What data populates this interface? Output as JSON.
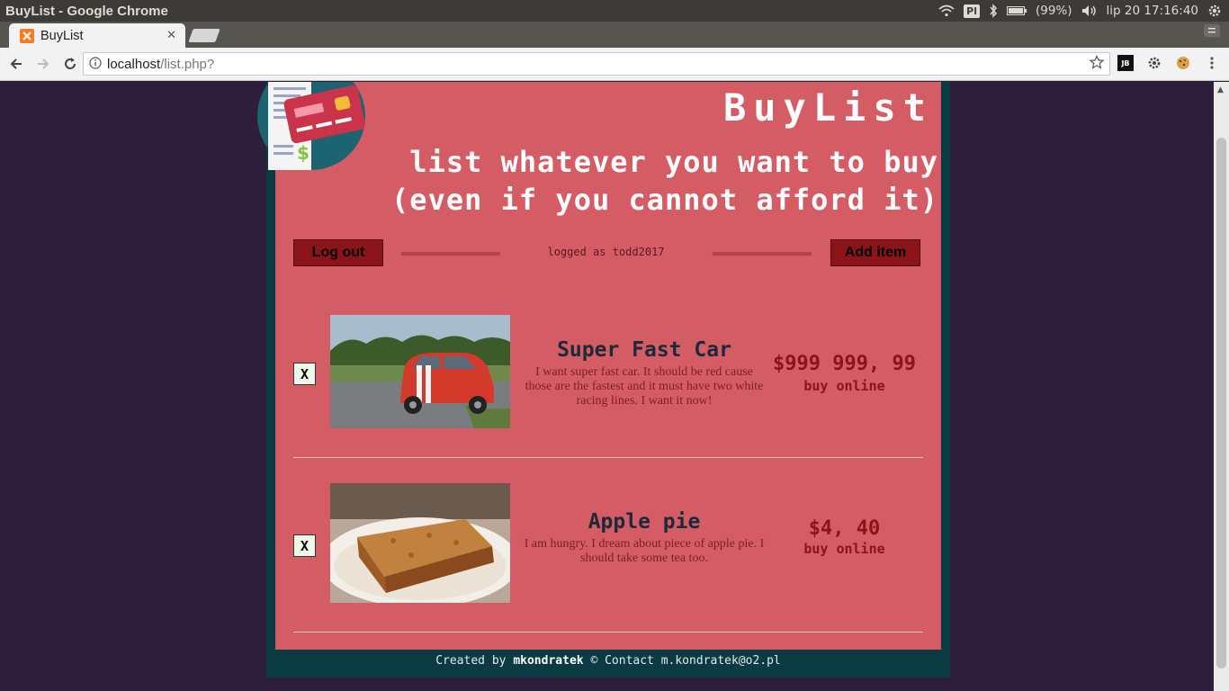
{
  "os": {
    "window_title": "BuyList - Google Chrome",
    "keyboard_layout": "Pl",
    "battery": "(99%)",
    "datetime": "lip 20 17:16:40"
  },
  "browser": {
    "tab_title": "BuyList",
    "url_host": "localhost",
    "url_path": "/list.php?"
  },
  "header": {
    "title": "BuyList",
    "tagline_1": "list whatever you want to buy",
    "tagline_2": "(even if you cannot afford it)"
  },
  "controls": {
    "logout_label": "Log out",
    "logged_as": "logged as todd2017",
    "add_label": "Add item"
  },
  "items": [
    {
      "remove_label": "X",
      "name": "Super Fast Car",
      "description": "I want super fast car. It should be red cause those are the fastest and it must have two white racing lines. I want it now!",
      "price": "$999 999, 99",
      "link": "buy online"
    },
    {
      "remove_label": "X",
      "name": "Apple pie",
      "description": "I am hungry. I dream about piece of apple pie. I should take some tea too.",
      "price": "$4, 40",
      "link": "buy online"
    }
  ],
  "footer": {
    "created_by": "Created by",
    "author": "mkondratek",
    "contact": "© Contact m.kondratek@o2.pl"
  },
  "colors": {
    "page_bg": "#2d1f3b",
    "frame": "#0a3a42",
    "panel": "#d45c65",
    "button": "#8a1418"
  }
}
